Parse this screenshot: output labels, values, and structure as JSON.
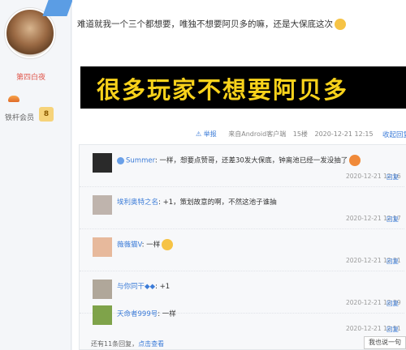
{
  "user": {
    "name": "第四白夜",
    "member_label": "铁杆会员",
    "member_level": "8"
  },
  "post": {
    "text": "难道就我一个三个都想要，唯独不想要阿贝多的嘛，还是大保底这次",
    "banner": "很多玩家不想要阿贝多",
    "report": "举报",
    "client": "来自Android客户端",
    "floor": "15楼",
    "time": "2020-12-21 12:15",
    "collapse": "收起回复"
  },
  "replies": [
    {
      "name": "Summer",
      "text": ": 一样，想要点赞哥，还差30发大保底，钟离池已经一发没抽了",
      "time": "2020-12-21 12:16",
      "action": "回复"
    },
    {
      "name": "埃利奥特之名",
      "text": ": +1，策划故意的啊，不然这池子谁抽",
      "time": "2020-12-21 12:17",
      "action": "回复"
    },
    {
      "name": "薇薇猫V",
      "text": ": 一样",
      "time": "2020-12-21 12:31",
      "action": "回复"
    },
    {
      "name": "与你同干◆◆",
      "text": ": +1",
      "time": "2020-12-21 12:39",
      "action": "回复"
    },
    {
      "name": "天命者999号",
      "text": ": 一样",
      "time": "2020-12-21 12:51",
      "action": "回复"
    }
  ],
  "footer": {
    "more_text": "还有11条回复，",
    "more_link": "点击查看",
    "say_button": "我也说一句"
  },
  "colors": {
    "link": "#3c7cd8",
    "banner_bg": "#000000",
    "banner_text": "#f8d21b",
    "username": "#e0584d"
  }
}
